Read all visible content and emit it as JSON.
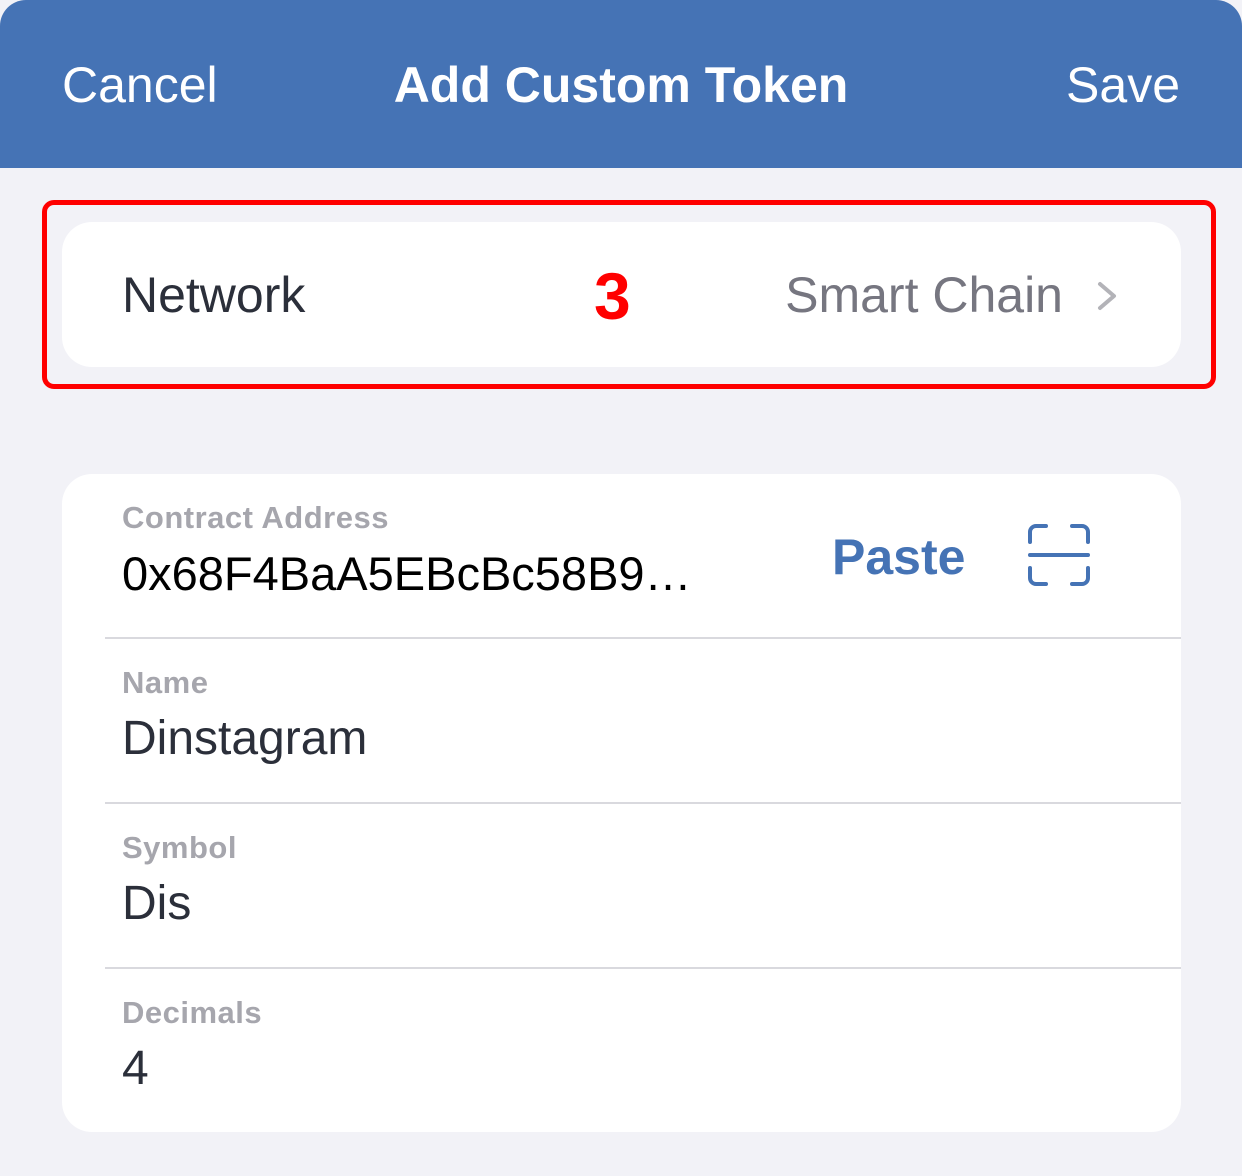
{
  "nav": {
    "cancel_label": "Cancel",
    "title": "Add Custom Token",
    "save_label": "Save"
  },
  "network": {
    "label": "Network",
    "value": "Smart Chain",
    "annotation": "3"
  },
  "fields": {
    "contract": {
      "label": "Contract Address",
      "value": "0x68F4BaA5EBcBc58B9…"
    },
    "name": {
      "label": "Name",
      "value": "Dinstagram"
    },
    "symbol": {
      "label": "Symbol",
      "value": "Dis"
    },
    "decimals": {
      "label": "Decimals",
      "value": "4"
    }
  },
  "actions": {
    "paste_label": "Paste"
  },
  "icons": {
    "chevron": "chevron-right-icon",
    "scan": "qr-scan-icon"
  },
  "colors": {
    "accent": "#4573b5",
    "background": "#f2f2f7",
    "highlight": "#ff0000"
  }
}
